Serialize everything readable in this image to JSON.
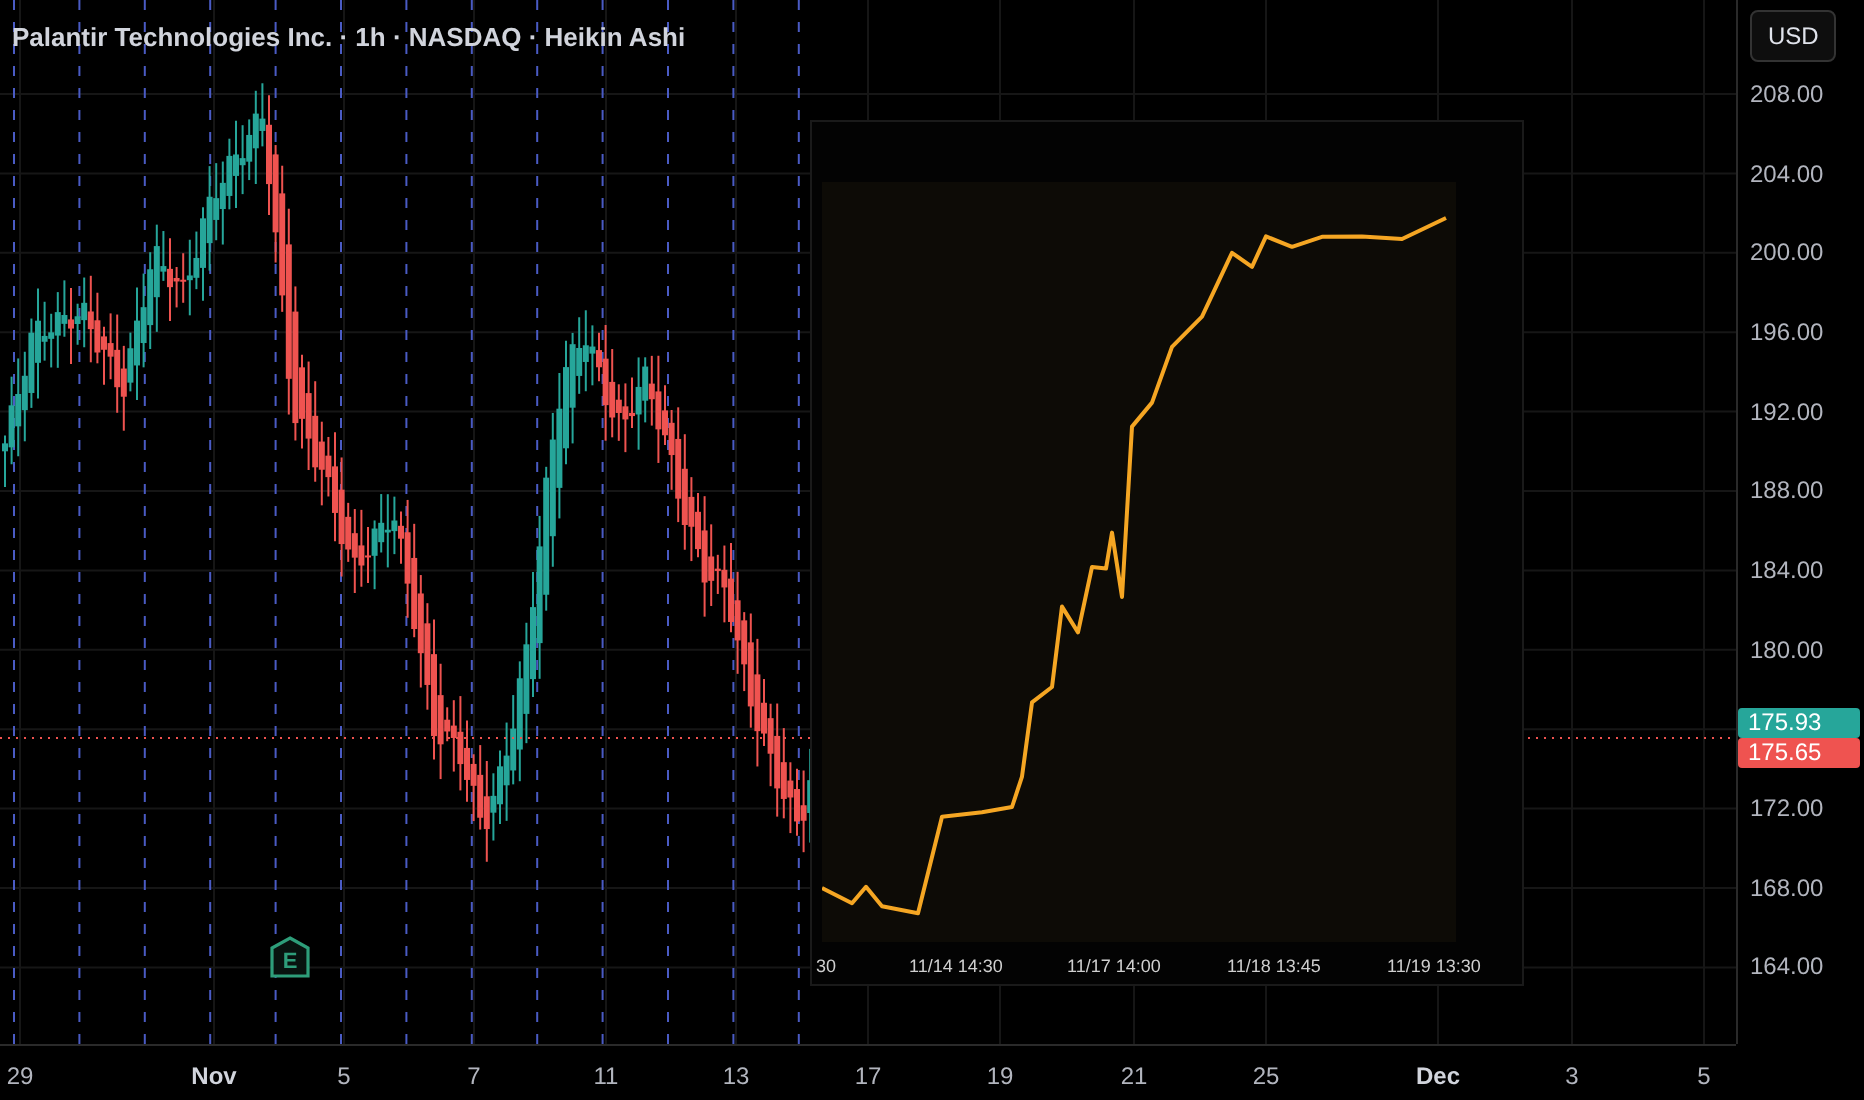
{
  "header": {
    "title": "Palantir Technologies Inc. · 1h · NASDAQ · Heikin Ashi"
  },
  "currency_button": "USD",
  "price_axis": {
    "upper_ticks": [
      "208.00",
      "204.00",
      "200.00",
      "196.00",
      "192.00",
      "188.00",
      "184.00",
      "180.00"
    ],
    "badges": [
      {
        "label": "175.93",
        "color": "#26a69a"
      },
      {
        "label": "175.65",
        "color": "#ef5350"
      }
    ],
    "lower_ticks": [
      "172.00",
      "168.00",
      "164.00"
    ]
  },
  "time_axis": [
    {
      "label": "29",
      "kind": "day"
    },
    {
      "label": "Nov",
      "kind": "month"
    },
    {
      "label": "5",
      "kind": "day"
    },
    {
      "label": "7",
      "kind": "day"
    },
    {
      "label": "11",
      "kind": "day"
    },
    {
      "label": "13",
      "kind": "day"
    },
    {
      "label": "17",
      "kind": "day"
    },
    {
      "label": "19",
      "kind": "day"
    },
    {
      "label": "21",
      "kind": "day"
    },
    {
      "label": "25",
      "kind": "day"
    },
    {
      "label": "Dec",
      "kind": "month"
    },
    {
      "label": "3",
      "kind": "day"
    },
    {
      "label": "5",
      "kind": "day"
    }
  ],
  "earnings_marker": {
    "label": "E"
  },
  "inset": {
    "x_labels": [
      "30",
      "11/14 14:30",
      "11/17 14:00",
      "11/18 13:45",
      "11/19 13:30"
    ]
  }
}
